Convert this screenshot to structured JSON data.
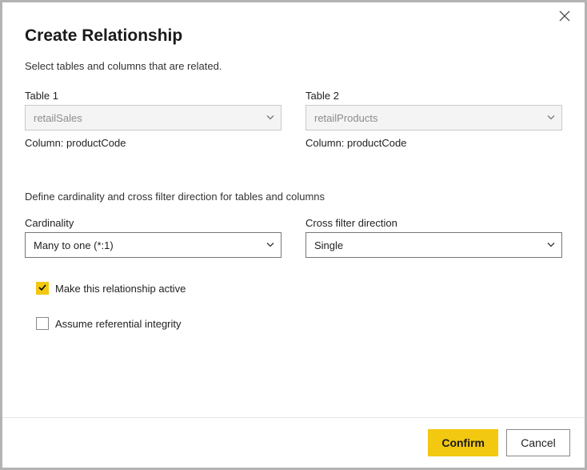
{
  "dialog": {
    "title": "Create Relationship",
    "subtitle": "Select tables and columns that are related."
  },
  "table1": {
    "label": "Table 1",
    "value": "retailSales",
    "column_prefix": "Column: ",
    "column_value": "productCode"
  },
  "table2": {
    "label": "Table 2",
    "value": "retailProducts",
    "column_prefix": "Column: ",
    "column_value": "productCode"
  },
  "define_line": "Define cardinality and cross filter direction for tables and columns",
  "cardinality": {
    "label": "Cardinality",
    "value": "Many to one (*:1)"
  },
  "crossfilter": {
    "label": "Cross filter direction",
    "value": "Single"
  },
  "checkbox_active": {
    "label": "Make this relationship active",
    "checked": true
  },
  "checkbox_ref_integrity": {
    "label": "Assume referential integrity",
    "checked": false
  },
  "buttons": {
    "confirm": "Confirm",
    "cancel": "Cancel"
  }
}
